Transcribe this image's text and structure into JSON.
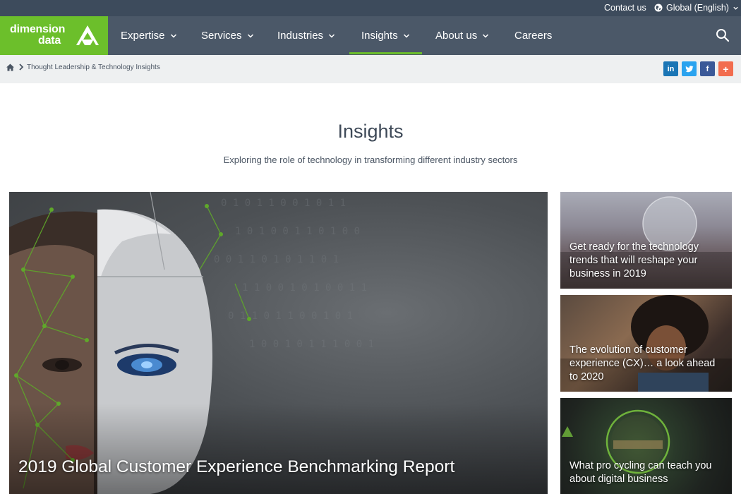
{
  "utility": {
    "contact_label": "Contact us",
    "language_label": "Global (English)"
  },
  "brand": {
    "line1": "dimension",
    "line2": "data",
    "accent_color": "#6cbf2b",
    "nav_color": "#4b5868"
  },
  "nav": {
    "items": [
      {
        "label": "Expertise",
        "has_menu": true
      },
      {
        "label": "Services",
        "has_menu": true
      },
      {
        "label": "Industries",
        "has_menu": true
      },
      {
        "label": "Insights",
        "has_menu": true,
        "active": true
      },
      {
        "label": "About us",
        "has_menu": true
      },
      {
        "label": "Careers",
        "has_menu": false
      }
    ],
    "search_icon": "search-icon"
  },
  "breadcrumb": {
    "home_icon": "home-icon",
    "current": "Thought Leadership & Technology Insights"
  },
  "share": {
    "linkedin": "in",
    "twitter": "twitter-icon",
    "facebook": "f",
    "more": "+"
  },
  "page": {
    "title": "Insights",
    "subtitle": "Exploring the role of technology in transforming different industry sectors"
  },
  "feature": {
    "title": "2019 Global Customer Experience Benchmarking Report"
  },
  "side_cards": [
    {
      "title": "Get ready for the technology trends that will reshape your business in 2019"
    },
    {
      "title": "The evolution of customer experience (CX)… a look ahead to 2020"
    },
    {
      "title": "What pro cycling can teach you about digital business"
    }
  ]
}
